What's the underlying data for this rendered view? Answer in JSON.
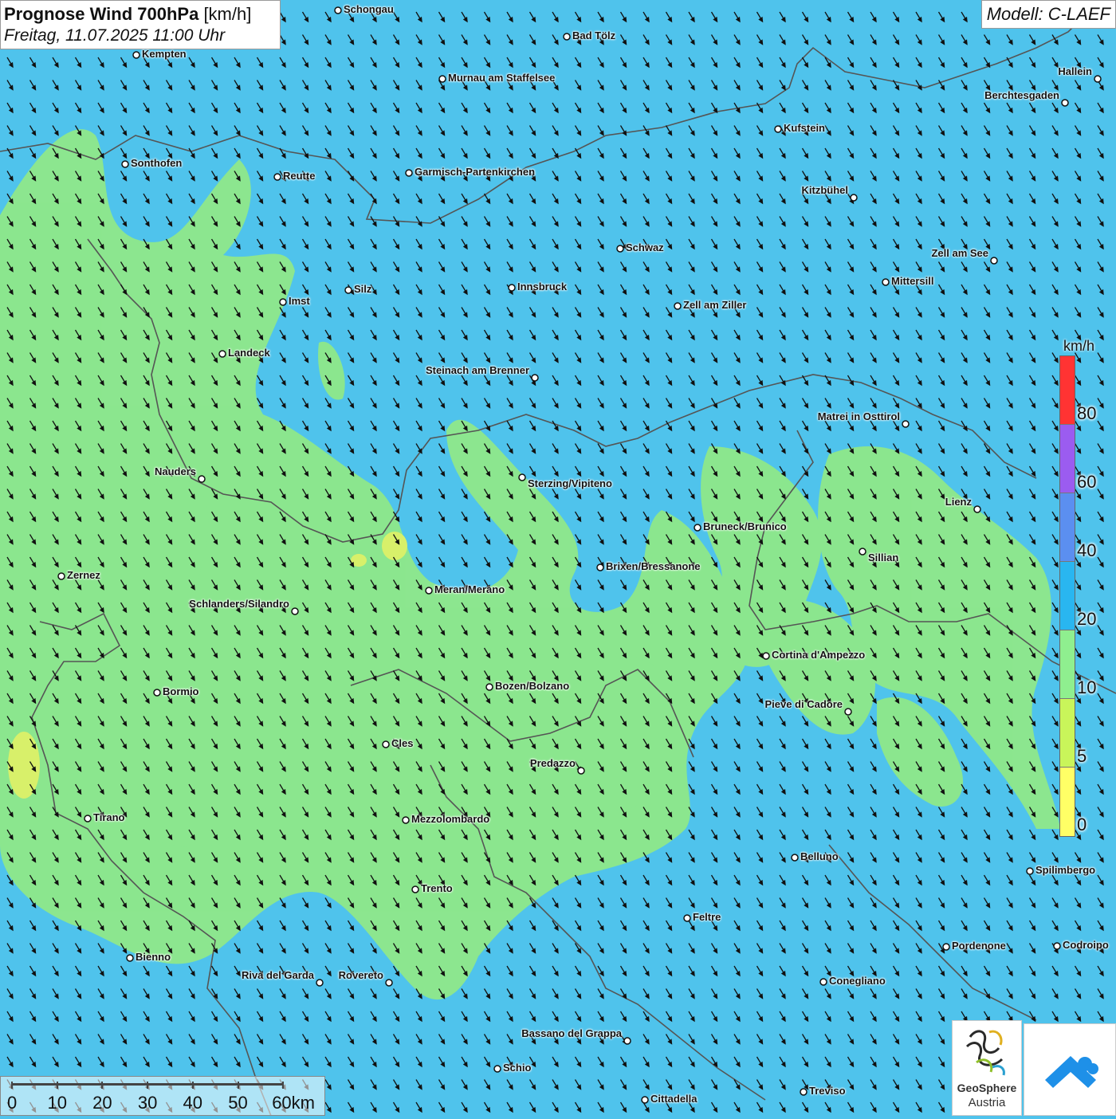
{
  "header": {
    "title_bold": "Prognose Wind 700hPa",
    "title_unit": "[km/h]",
    "subtitle": "Freitag, 11.07.2025 11:00 Uhr",
    "model": "Modell: C-LAEF"
  },
  "legend": {
    "unit": "km/h",
    "colors": [
      "#ff3333",
      "#9b5cf0",
      "#5b8ff0",
      "#29b6f0",
      "#8fef8f",
      "#c9f55a",
      "#ffff66"
    ],
    "labels": [
      "80",
      "60",
      "40",
      "20",
      "10",
      "5",
      "0"
    ]
  },
  "map": {
    "colors": {
      "background": "#4fc3ec",
      "low_wind": "#8fe88a",
      "very_low_wind": "#d8f06a",
      "border": "#555555"
    },
    "wind_direction": "northwest",
    "cities": [
      {
        "name": "Schongau"
      },
      {
        "name": "Bad Tölz"
      },
      {
        "name": "Kempten"
      },
      {
        "name": "Murnau am Staffelsee"
      },
      {
        "name": "Hallein"
      },
      {
        "name": "Berchtesgaden"
      },
      {
        "name": "Kufstein"
      },
      {
        "name": "Sonthofen"
      },
      {
        "name": "Reutte"
      },
      {
        "name": "Garmisch-Partenkirchen"
      },
      {
        "name": "Kitzbühel"
      },
      {
        "name": "Schwaz"
      },
      {
        "name": "Zell am See"
      },
      {
        "name": "Mittersill"
      },
      {
        "name": "Silz"
      },
      {
        "name": "Innsbruck"
      },
      {
        "name": "Imst"
      },
      {
        "name": "Zell am Ziller"
      },
      {
        "name": "Landeck"
      },
      {
        "name": "Steinach am Brenner"
      },
      {
        "name": "Matrei in Osttirol"
      },
      {
        "name": "Nauders"
      },
      {
        "name": "Sterzing/Vipiteno"
      },
      {
        "name": "Lienz"
      },
      {
        "name": "Bruneck/Brunico"
      },
      {
        "name": "Sillian"
      },
      {
        "name": "Brixen/Bressanone"
      },
      {
        "name": "Zernez"
      },
      {
        "name": "Meran/Merano"
      },
      {
        "name": "Schlanders/Silandro"
      },
      {
        "name": "Cortina d'Ampezzo"
      },
      {
        "name": "Bozen/Bolzano"
      },
      {
        "name": "Bormio"
      },
      {
        "name": "Pieve di Cadore"
      },
      {
        "name": "Cles"
      },
      {
        "name": "Predazzo"
      },
      {
        "name": "Tirano"
      },
      {
        "name": "Mezzolombardo"
      },
      {
        "name": "Belluno"
      },
      {
        "name": "Spilimbergo"
      },
      {
        "name": "Trento"
      },
      {
        "name": "Feltre"
      },
      {
        "name": "Pordenone"
      },
      {
        "name": "Codroipo"
      },
      {
        "name": "Bienno"
      },
      {
        "name": "Riva del Garda"
      },
      {
        "name": "Rovereto"
      },
      {
        "name": "Conegliano"
      },
      {
        "name": "Bassano del Grappa"
      },
      {
        "name": "Schio"
      },
      {
        "name": "Treviso"
      },
      {
        "name": "Cittadella"
      }
    ]
  },
  "scale": {
    "labels": [
      "0",
      "10",
      "20",
      "30",
      "40",
      "50",
      "60km"
    ]
  },
  "logos": {
    "geosphere_line1": "GeoSphere",
    "geosphere_line2": "Austria"
  }
}
